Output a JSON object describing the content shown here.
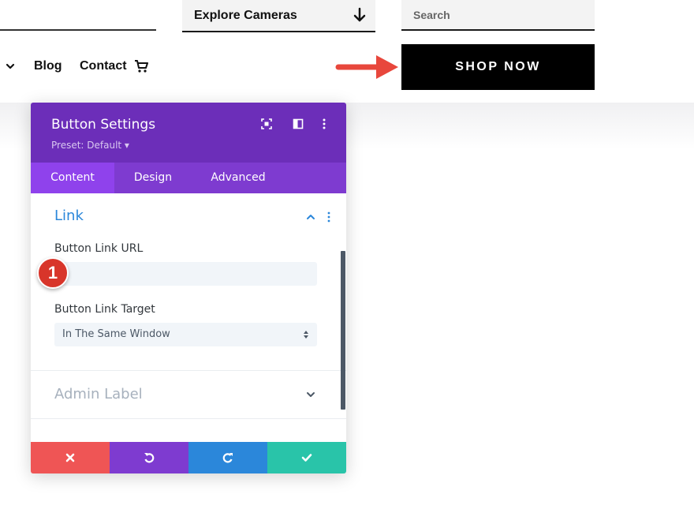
{
  "header": {
    "explore_label": "Explore Cameras",
    "search_placeholder": "Search",
    "nav": {
      "blog": "Blog",
      "contact": "Contact"
    },
    "shop_now": "SHOP NOW"
  },
  "modal": {
    "title": "Button Settings",
    "preset": "Preset: Default ▾",
    "tabs": [
      {
        "label": "Content",
        "active": true
      },
      {
        "label": "Design",
        "active": false
      },
      {
        "label": "Advanced",
        "active": false
      }
    ],
    "link_section": {
      "title": "Link",
      "url_label": "Button Link URL",
      "url_value": "",
      "target_label": "Button Link Target",
      "target_value": "In The Same Window"
    },
    "admin_section": {
      "title": "Admin Label"
    },
    "step_badge": "1",
    "footer_buttons": [
      {
        "name": "cancel",
        "icon": "close-icon",
        "color": "#ef5555"
      },
      {
        "name": "undo",
        "icon": "undo-icon",
        "color": "#7e3bd0"
      },
      {
        "name": "redo",
        "icon": "redo-icon",
        "color": "#2b87da"
      },
      {
        "name": "save",
        "icon": "check-icon",
        "color": "#29c4a9"
      }
    ]
  },
  "colors": {
    "header_purple": "#6c2eb9",
    "tabs_purple": "#7e3bd0",
    "active_tab": "#8f42ec",
    "link_blue": "#2b87da",
    "arrow_red": "#e8473c"
  }
}
